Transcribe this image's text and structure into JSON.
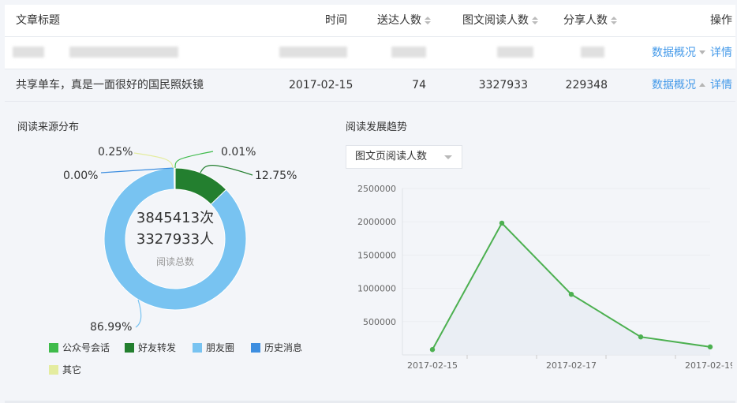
{
  "table": {
    "headers": {
      "title": "文章标题",
      "time": "时间",
      "sent": "送达人数",
      "read": "图文阅读人数",
      "share": "分享人数",
      "op": "操作"
    },
    "rows": [
      {
        "title": "",
        "time": "",
        "sent": "",
        "read": "",
        "share": "",
        "overview": "数据概况",
        "detail": "详情",
        "expanded": false,
        "blurred": true
      },
      {
        "title": "共享单车，真是一面很好的国民照妖镜",
        "time": "2017-02-15",
        "sent": "74",
        "read": "3327933",
        "share": "229348",
        "overview": "数据概况",
        "detail": "详情",
        "expanded": true,
        "blurred": false
      }
    ]
  },
  "source_panel": {
    "title": "阅读来源分布",
    "center_line1": "3845413次",
    "center_line2": "3327933人",
    "center_caption": "阅读总数",
    "legend": [
      {
        "label": "公众号会话",
        "color": "#3fbb4b"
      },
      {
        "label": "好友转发",
        "color": "#237f2f"
      },
      {
        "label": "朋友圈",
        "color": "#78c3f1"
      },
      {
        "label": "历史消息",
        "color": "#3d8ee0"
      },
      {
        "label": "其它",
        "color": "#e4ec9f"
      }
    ]
  },
  "trend_panel": {
    "title": "阅读发展趋势",
    "dropdown_value": "图文页阅读人数"
  },
  "chart_data": [
    {
      "type": "pie",
      "title": "阅读来源分布",
      "categories": [
        "公众号会话",
        "好友转发",
        "朋友圈",
        "历史消息",
        "其它"
      ],
      "values": [
        0.01,
        12.75,
        86.99,
        0.0,
        0.25
      ],
      "value_labels": [
        "0.01%",
        "12.75%",
        "86.99%",
        "0.00%",
        "0.25%"
      ],
      "colors": [
        "#3fbb4b",
        "#237f2f",
        "#78c3f1",
        "#3d8ee0",
        "#e4ec9f"
      ],
      "legend": "bottom"
    },
    {
      "type": "area",
      "title": "阅读发展趋势",
      "x": [
        "2017-02-15",
        "2017-02-16",
        "2017-02-17",
        "2017-02-18",
        "2017-02-19"
      ],
      "x_tick_labels": [
        "2017-02-15",
        "",
        "2017-02-17",
        "",
        "2017-02-19"
      ],
      "series": [
        {
          "values": [
            80000,
            1980000,
            910000,
            270000,
            120000
          ]
        }
      ],
      "y_ticks": [
        "2500000",
        "2000000",
        "1500000",
        "1000000",
        "500000"
      ],
      "ylim": [
        0,
        2500000
      ],
      "line_color": "#4cb050",
      "grid": true
    }
  ]
}
